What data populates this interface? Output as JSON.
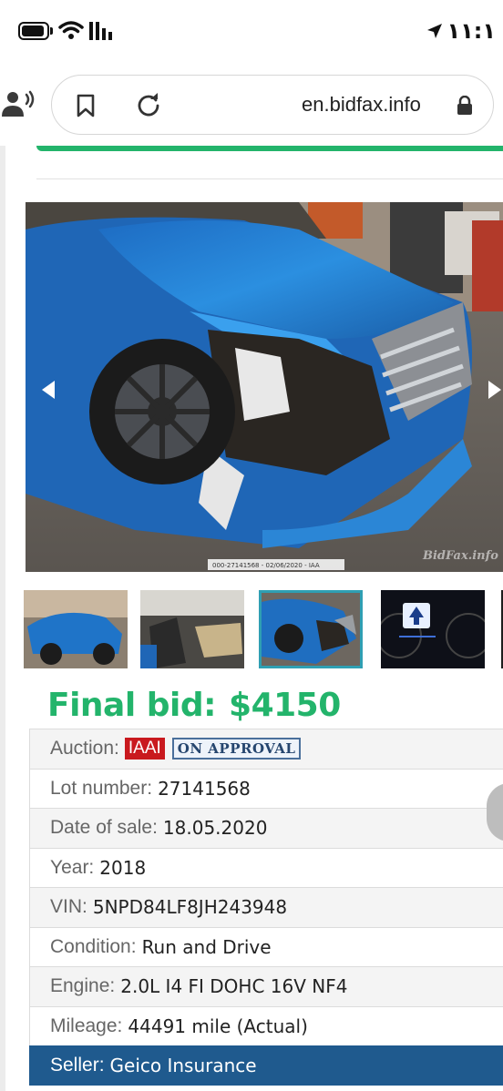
{
  "status_bar": {
    "time": "١١:١",
    "icons": [
      "battery-icon",
      "wifi-icon",
      "signal-icon",
      "location-arrow-icon"
    ]
  },
  "browser": {
    "url": "en.bidfax.info",
    "icons": [
      "reader-mode-icon",
      "bookmark-icon",
      "reload-icon",
      "lock-icon"
    ]
  },
  "gallery": {
    "main_caption": "000-27141568 - 02/06/2020 - IAA",
    "watermark": "BidFax.info",
    "thumbnails": [
      "car-rear-side",
      "car-interior",
      "car-front-damage",
      "dashboard-display"
    ],
    "selected_index": 2
  },
  "final_bid": {
    "label": "Final bid:",
    "amount": "$4150"
  },
  "details": {
    "auction": {
      "label": "Auction:",
      "badge": "IAAI",
      "status": "ON APPROVAL"
    },
    "lot": {
      "label": "Lot number:",
      "value": "27141568"
    },
    "date": {
      "label": "Date of sale:",
      "value": "18.05.2020"
    },
    "year": {
      "label": "Year:",
      "value": "2018"
    },
    "vin": {
      "label": "VIN:",
      "value": "5NPD84LF8JH243948"
    },
    "condition": {
      "label": "Condition:",
      "value": "Run and Drive"
    },
    "engine": {
      "label": "Engine:",
      "value": "2.0L I4 FI DOHC 16V NF4"
    },
    "mileage": {
      "label": "Mileage:",
      "value": "44491 mile (Actual)"
    },
    "seller": {
      "label": "Seller:",
      "value": "Geico Insurance"
    }
  },
  "colors": {
    "accent_green": "#23b46b",
    "seller_bar": "#1f5a8e",
    "iaai_red": "#c9191e",
    "thumb_selected": "#2f9fb3"
  }
}
